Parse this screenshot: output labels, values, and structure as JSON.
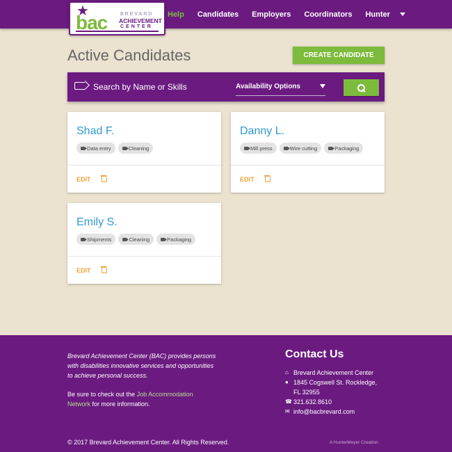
{
  "header": {
    "logo": {
      "mark": "bac",
      "line1": "BREVARD",
      "line2": "ACHIEVEMENT",
      "line3": "CENTER"
    },
    "nav": {
      "help": "Help",
      "candidates": "Candidates",
      "employers": "Employers",
      "coordinators": "Coordinators",
      "user": "Hunter"
    }
  },
  "main": {
    "title": "Active Candidates",
    "create_button": "CREATE CANDIDATE",
    "search": {
      "placeholder": "Search by Name or Skills",
      "availability": "Availability Options"
    },
    "candidates": [
      {
        "name": "Shad F.",
        "skills": [
          "Data entry",
          "Cleaning"
        ],
        "edit": "EDIT"
      },
      {
        "name": "Danny L.",
        "skills": [
          "Mill press",
          "Wire cutting",
          "Packaging"
        ],
        "edit": "EDIT"
      },
      {
        "name": "Emily S.",
        "skills": [
          "Shipments",
          "Cleaning",
          "Packaging"
        ],
        "edit": "EDIT"
      }
    ]
  },
  "footer": {
    "about": "Brevard Achievement Center (BAC) provides persons with disabilities innovative services and opportunities to achieve personal success.",
    "more_prefix": "Be sure to check out the ",
    "more_link": "Job Accommodation Network",
    "more_suffix": " for more information.",
    "contact_title": "Contact Us",
    "contact": {
      "org": "Brevard Achievement Center",
      "address1": "1845 Cogswell St. Rockledge,",
      "address2": "FL 32955",
      "phone": "321.632.8610",
      "email": "info@bacbrevard.com"
    },
    "copyright": "© 2017 Brevard Achievement Center. All Rights Reserved.",
    "credit": "A HunterMeyer Creation"
  },
  "colors": {
    "brand_purple": "#6b1b80",
    "brand_green": "#7dbb3c",
    "background": "#ebe2cf",
    "link_blue": "#2f9ad1",
    "edit_orange": "#f0a43a"
  },
  "icons": {
    "logo_star": "star-icon",
    "search_tag": "tag-icon",
    "search_button": "search-icon",
    "skill_chip": "tag-icon",
    "delete": "trash-icon",
    "nav_dropdown": "caret-down-icon",
    "contact_org": "home-icon",
    "contact_address": "map-marker-icon",
    "contact_phone": "phone-icon",
    "contact_email": "envelope-icon"
  }
}
